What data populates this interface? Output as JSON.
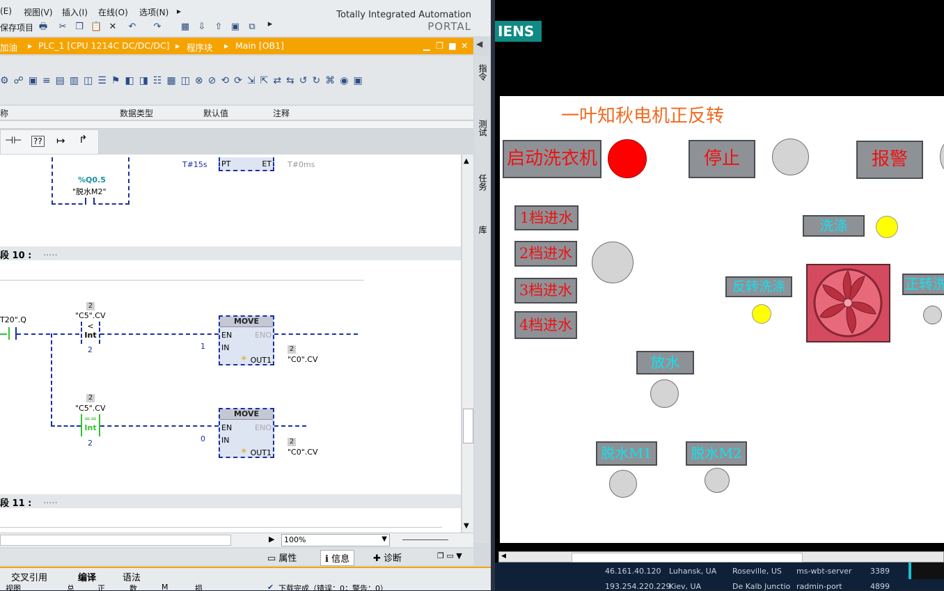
{
  "menu": [
    "(E)",
    "视图(V)",
    "插入(I)",
    "在线(O)",
    "选项(N)"
  ],
  "toolbar": {
    "save_label": "保存项目"
  },
  "portal": {
    "line1": "Totally Integrated Automation",
    "line2": "PORTAL"
  },
  "breadcrumb": [
    "加油",
    "PLC_1 [CPU 1214C DC/DC/DC]",
    "程序块",
    "Main [OB1]"
  ],
  "columns": [
    "称",
    "数据类型",
    "默认值",
    "注释"
  ],
  "side_tabs": [
    "指令",
    "测试",
    "任务",
    "库"
  ],
  "ladder": {
    "timer_pt": "T#15s",
    "pin_pt": "PT",
    "pin_et": "ET",
    "timer_et": "T#0ms",
    "coil_addr": "%Q0.5",
    "coil_name": "\"脱水M2\"",
    "segment10": "段 10 :",
    "segment11": "段 11 :",
    "segment_dots": ".....",
    "contact_t20": "T20\".Q",
    "cmp1": {
      "badge": "2",
      "name": "\"C5\".CV",
      "op": "<",
      "type": "Int",
      "operand": "2"
    },
    "cmp2": {
      "badge": "2",
      "name": "\"C5\".CV",
      "op": "==",
      "type": "Int",
      "operand": "2"
    },
    "move1": {
      "title": "MOVE",
      "en": "EN",
      "eno": "ENO",
      "in": "IN",
      "out": "OUT1",
      "in_val": "1",
      "out_badge": "2",
      "out_name": "\"C0\".CV"
    },
    "move2": {
      "title": "MOVE",
      "en": "EN",
      "eno": "ENO",
      "in": "IN",
      "out": "OUT1",
      "in_val": "0",
      "out_badge": "2",
      "out_name": "\"C0\".CV"
    }
  },
  "zoom": "100%",
  "info_tabs": [
    "属性",
    "信息",
    "诊断"
  ],
  "bottom_tabs": [
    "交叉引用",
    "编译",
    "语法"
  ],
  "taskbar": [
    "视图",
    "总",
    "正",
    "数",
    "M",
    "损"
  ],
  "status_text": "下载完成（错误：0；警告：0）",
  "hmi": {
    "brand": "IENS",
    "title": "一叶知秋电机正反转",
    "buttons": {
      "start": "启动洗衣机",
      "stop": "停止",
      "alarm": "报警",
      "gear1": "1档进水",
      "gear2": "2档进水",
      "gear3": "3档进水",
      "gear4": "4档进水",
      "wash": "洗涤",
      "reverse": "反转洗涤",
      "forward": "正转洗",
      "drain": "放水",
      "spin1": "脱水M1",
      "spin2": "脱水M2"
    },
    "colors": {
      "start_lamp": "#ff0000",
      "wash_lamp": "#ffff00",
      "reverse_lamp": "#ffff00",
      "off_lamp": "#d4d4d4",
      "fan": "#d44a5e"
    }
  },
  "network_table": [
    [
      "46.161.40.120",
      "Luhansk, UA",
      "Roseville, US",
      "ms-wbt-server",
      "3389"
    ],
    [
      "193.254.220.229",
      "Kiev, UA",
      "De Kalb Junctio",
      "radmin-port",
      "4899"
    ]
  ]
}
